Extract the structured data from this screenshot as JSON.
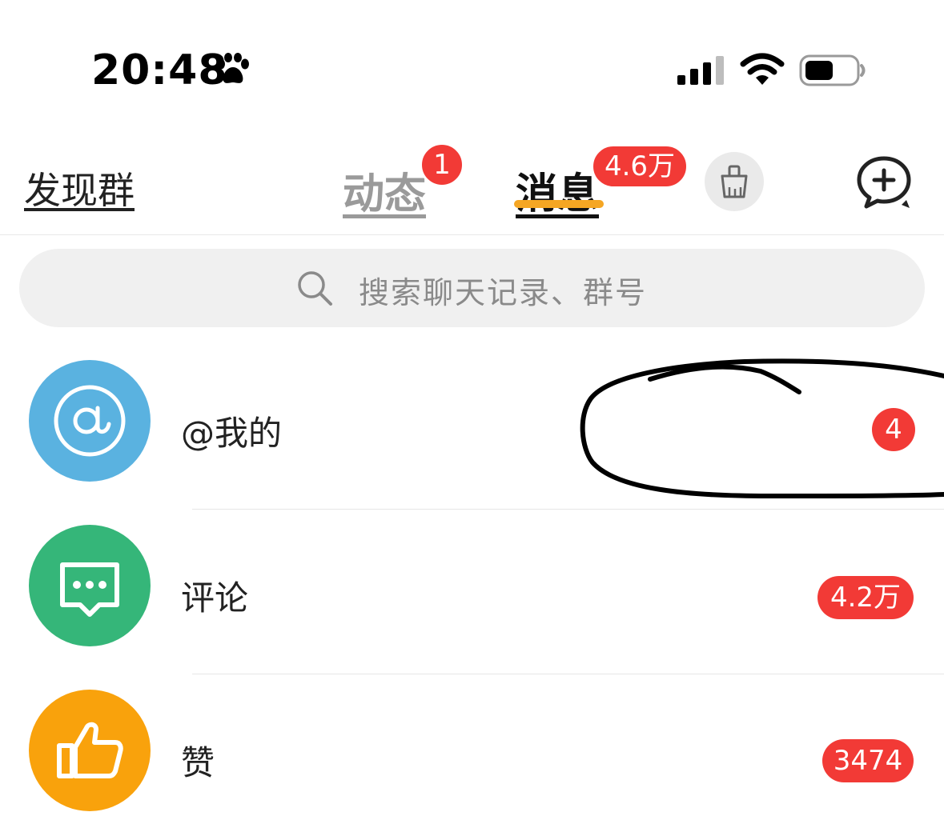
{
  "status_bar": {
    "time": "20:48",
    "icons": [
      "paw-icon",
      "signal-icon",
      "wifi-icon",
      "battery-icon"
    ]
  },
  "nav": {
    "discover_label": "发现群",
    "tabs": [
      {
        "label": "动态",
        "badge": "1",
        "active": false
      },
      {
        "label": "消息",
        "badge": "4.6万",
        "active": true
      }
    ],
    "accent_color": "#f5a623",
    "badge_color": "#f23a36",
    "icons": [
      "broom-icon",
      "add-chat-icon"
    ]
  },
  "search": {
    "placeholder": "搜索聊天记录、群号",
    "icon": "search-icon"
  },
  "list": {
    "items": [
      {
        "label": "@我的",
        "count": "4",
        "icon": "at-icon",
        "color": "#5ab2e0"
      },
      {
        "label": "评论",
        "count": "4.2万",
        "icon": "comment-icon",
        "color": "#35b679"
      },
      {
        "label": "赞",
        "count": "3474",
        "icon": "thumbs-up-icon",
        "color": "#f9a20c"
      }
    ]
  }
}
